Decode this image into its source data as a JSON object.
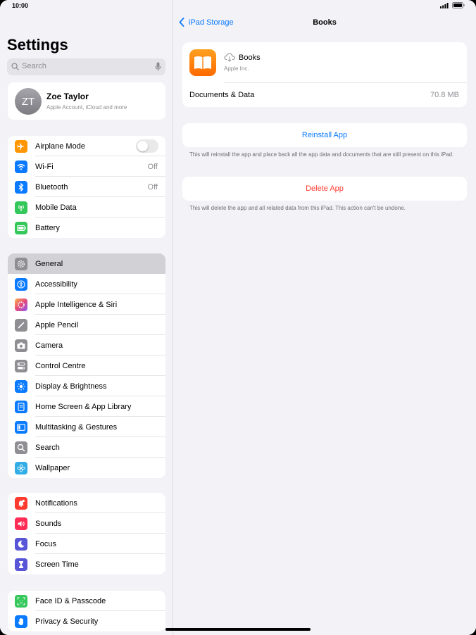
{
  "status": {
    "time": "10:00"
  },
  "sidebar": {
    "title": "Settings",
    "search": {
      "placeholder": "Search"
    },
    "profile": {
      "initials": "ZT",
      "name": "Zoe Taylor",
      "subtitle": "Apple Account, iCloud and more"
    },
    "groups": [
      [
        {
          "label": "Airplane Mode",
          "icon": "airplane-icon",
          "color": "#ff9500",
          "toggle": false
        },
        {
          "label": "Wi-Fi",
          "icon": "wifi-icon",
          "color": "#0a7aff",
          "value": "Off"
        },
        {
          "label": "Bluetooth",
          "icon": "bluetooth-icon",
          "color": "#0a7aff",
          "value": "Off"
        },
        {
          "label": "Mobile Data",
          "icon": "antenna-icon",
          "color": "#34c759"
        },
        {
          "label": "Battery",
          "icon": "battery-icon",
          "color": "#34c759"
        }
      ],
      [
        {
          "label": "General",
          "icon": "gear-icon",
          "color": "#8e8e93",
          "selected": true
        },
        {
          "label": "Accessibility",
          "icon": "accessibility-icon",
          "color": "#0a7aff"
        },
        {
          "label": "Apple Intelligence & Siri",
          "icon": "siri-icon",
          "color": "#e5487d"
        },
        {
          "label": "Apple Pencil",
          "icon": "pencil-icon",
          "color": "#8e8e93"
        },
        {
          "label": "Camera",
          "icon": "camera-icon",
          "color": "#8e8e93"
        },
        {
          "label": "Control Centre",
          "icon": "switches-icon",
          "color": "#8e8e93"
        },
        {
          "label": "Display & Brightness",
          "icon": "sun-icon",
          "color": "#0a7aff"
        },
        {
          "label": "Home Screen & App Library",
          "icon": "home-screen-icon",
          "color": "#0a7aff"
        },
        {
          "label": "Multitasking & Gestures",
          "icon": "multitasking-icon",
          "color": "#0a7aff"
        },
        {
          "label": "Search",
          "icon": "search-icon",
          "color": "#8e8e93"
        },
        {
          "label": "Wallpaper",
          "icon": "flower-icon",
          "color": "#32ade6"
        }
      ],
      [
        {
          "label": "Notifications",
          "icon": "bell-icon",
          "color": "#ff3b30"
        },
        {
          "label": "Sounds",
          "icon": "speaker-icon",
          "color": "#ff2d55"
        },
        {
          "label": "Focus",
          "icon": "moon-icon",
          "color": "#5856d6"
        },
        {
          "label": "Screen Time",
          "icon": "hourglass-icon",
          "color": "#5856d6"
        }
      ],
      [
        {
          "label": "Face ID & Passcode",
          "icon": "face-id-icon",
          "color": "#34c759"
        },
        {
          "label": "Privacy & Security",
          "icon": "hand-icon",
          "color": "#0a7aff"
        }
      ]
    ]
  },
  "detail": {
    "back_label": "iPad Storage",
    "title": "Books",
    "app": {
      "name": "Books",
      "developer": "Apple Inc.",
      "icon": "books-icon"
    },
    "documents": {
      "label": "Documents & Data",
      "value": "70.8 MB"
    },
    "reinstall": {
      "label": "Reinstall App",
      "note": "This will reinstall the app and place back all the app data and documents that are still present on this iPad."
    },
    "delete": {
      "label": "Delete App",
      "note": "This will delete the app and all related data from this iPad. This action can't be undone."
    }
  },
  "colors": {
    "accent": "#0a7aff",
    "destructive": "#ff3b30"
  }
}
